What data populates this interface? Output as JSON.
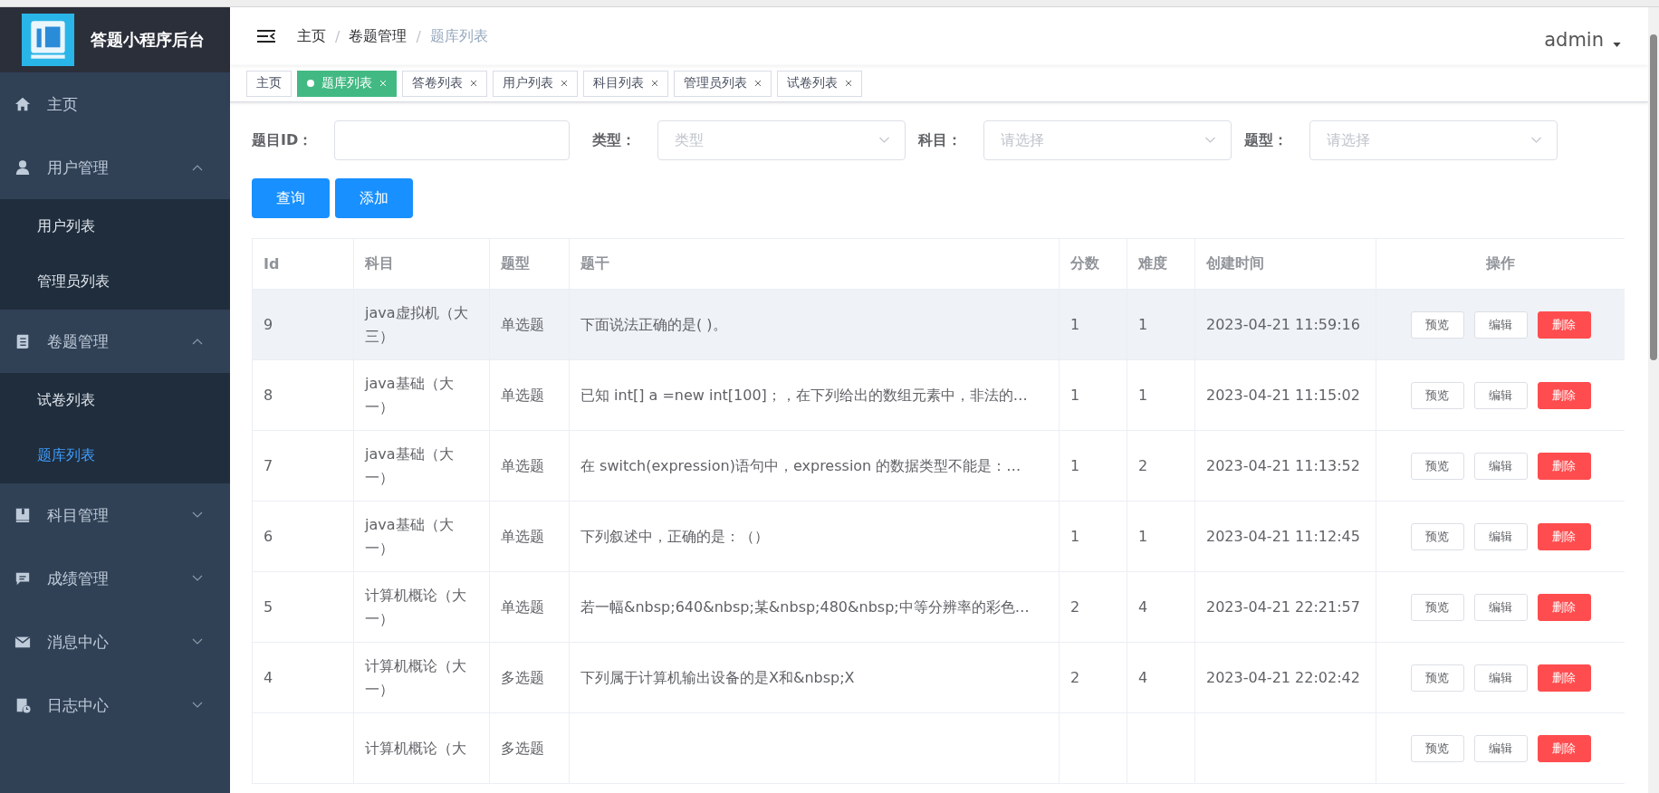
{
  "app": {
    "title": "答题小程序后台"
  },
  "sidebar": {
    "items": [
      {
        "label": "主页",
        "kind": "link",
        "selected": false
      },
      {
        "label": "用户管理",
        "kind": "group",
        "expanded": true,
        "children": [
          {
            "label": "用户列表",
            "selected": false
          },
          {
            "label": "管理员列表",
            "selected": false
          }
        ]
      },
      {
        "label": "卷题管理",
        "kind": "group",
        "expanded": true,
        "children": [
          {
            "label": "试卷列表",
            "selected": false
          },
          {
            "label": "题库列表",
            "selected": true
          }
        ]
      },
      {
        "label": "科目管理",
        "kind": "group",
        "expanded": false
      },
      {
        "label": "成绩管理",
        "kind": "group",
        "expanded": false
      },
      {
        "label": "消息中心",
        "kind": "group",
        "expanded": false
      },
      {
        "label": "日志中心",
        "kind": "group",
        "expanded": false
      }
    ]
  },
  "breadcrumb": {
    "separator": "/",
    "items": [
      "主页",
      "卷题管理",
      "题库列表"
    ]
  },
  "user": {
    "name": "admin"
  },
  "tags": [
    {
      "label": "主页",
      "selected": false,
      "closable": false
    },
    {
      "label": "题库列表",
      "selected": true,
      "closable": true
    },
    {
      "label": "答卷列表",
      "selected": false,
      "closable": true
    },
    {
      "label": "用户列表",
      "selected": false,
      "closable": true
    },
    {
      "label": "科目列表",
      "selected": false,
      "closable": true
    },
    {
      "label": "管理员列表",
      "selected": false,
      "closable": true
    },
    {
      "label": "试卷列表",
      "selected": false,
      "closable": true
    }
  ],
  "filters": [
    {
      "kind": "input",
      "label": "题目ID："
    },
    {
      "kind": "select",
      "label": "类型：",
      "placeholder": "类型"
    },
    {
      "kind": "select",
      "label": "科目：",
      "placeholder": "请选择"
    },
    {
      "kind": "select",
      "label": "题型：",
      "placeholder": "请选择"
    }
  ],
  "actions": [
    "查询",
    "添加"
  ],
  "table": {
    "columns": [
      "Id",
      "科目",
      "题型",
      "题干",
      "分数",
      "难度",
      "创建时间",
      "操作"
    ],
    "rows": [
      {
        "hovered": true,
        "cells": [
          "9",
          "java虚拟机（大三）",
          "单选题",
          "下面说法正确的是( )。",
          "1",
          "1",
          "2023-04-21 11:59:16"
        ],
        "buttons": [
          "预览",
          "编辑",
          "删除"
        ]
      },
      {
        "hovered": false,
        "cells": [
          "8",
          "java基础（大一）",
          "单选题",
          "已知 int[] a =new int[100]；，在下列给出的数组元素中，非法的…",
          "1",
          "1",
          "2023-04-21 11:15:02"
        ],
        "buttons": [
          "预览",
          "编辑",
          "删除"
        ]
      },
      {
        "hovered": false,
        "cells": [
          "7",
          "java基础（大一）",
          "单选题",
          "在 switch(expression)语句中，expression 的数据类型不能是：…",
          "1",
          "2",
          "2023-04-21 11:13:52"
        ],
        "buttons": [
          "预览",
          "编辑",
          "删除"
        ]
      },
      {
        "hovered": false,
        "cells": [
          "6",
          "java基础（大一）",
          "单选题",
          "下列叙述中，正确的是：（）",
          "1",
          "1",
          "2023-04-21 11:12:45"
        ],
        "buttons": [
          "预览",
          "编辑",
          "删除"
        ]
      },
      {
        "hovered": false,
        "cells": [
          "5",
          "计算机概论（大一）",
          "单选题",
          "若一幅&nbsp;640&nbsp;某&nbsp;480&nbsp;中等分辨率的彩色…",
          "2",
          "4",
          "2023-04-21 22:21:57"
        ],
        "buttons": [
          "预览",
          "编辑",
          "删除"
        ]
      },
      {
        "hovered": false,
        "cells": [
          "4",
          "计算机概论（大一）",
          "多选题",
          "下列属于计算机输出设备的是X和&nbsp;X",
          "2",
          "4",
          "2023-04-21 22:02:42"
        ],
        "buttons": [
          "预览",
          "编辑",
          "删除"
        ]
      },
      {
        "hovered": false,
        "cells": [
          null,
          "计算机概论（大",
          "多选题"
        ],
        "buttons": [
          "预览",
          "编辑",
          "删除"
        ]
      }
    ]
  }
}
